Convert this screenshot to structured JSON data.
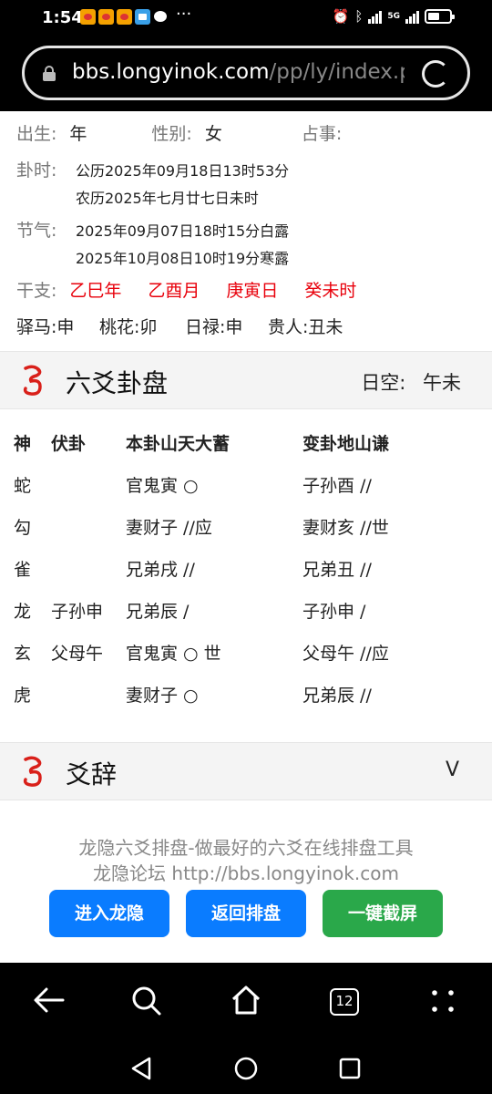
{
  "status_bar": {
    "time": "1:54",
    "more": "···",
    "network": "5G"
  },
  "browser": {
    "url_host": "bbs.longyinok.com",
    "url_path": "/pp/ly/index.ph"
  },
  "info": {
    "birth_label": "出生:",
    "birth_value": "年",
    "gender_label": "性别:",
    "gender_value": "女",
    "matter_label": "占事:",
    "time_label": "卦时:",
    "solar": "公历2025年09月18日13时53分",
    "lunar": "农历2025年七月廿七日未时",
    "term_label": "节气:",
    "term1": "2025年09月07日18时15分白露",
    "term2": "2025年10月08日10时19分寒露",
    "ganzhi_label": "干支:",
    "ganzhi": [
      "乙巳年",
      "乙酉月",
      "庚寅日",
      "癸未时"
    ],
    "shensha": [
      "驿马:申",
      "桃花:卯",
      "日禄:申",
      "贵人:丑未"
    ]
  },
  "liuyao_section": {
    "title": "六爻卦盘",
    "void_label": "日空:",
    "void_value": "午未"
  },
  "table": {
    "headers": [
      "神",
      "伏卦",
      "本卦山天大蓄",
      "变卦地山谦"
    ],
    "rows": [
      [
        "蛇",
        "",
        "官鬼寅 ○",
        "子孙酉 //"
      ],
      [
        "勾",
        "",
        "妻财子 //应",
        "妻财亥 //世"
      ],
      [
        "雀",
        "",
        "兄弟戌 //",
        "兄弟丑 //"
      ],
      [
        "龙",
        "子孙申",
        "兄弟辰  /",
        "子孙申  /"
      ],
      [
        "玄",
        "父母午",
        "官鬼寅 ○ 世",
        "父母午 //应"
      ],
      [
        "虎",
        "",
        "妻财子 ○",
        "兄弟辰 //"
      ]
    ]
  },
  "yaoci_section": {
    "title": "爻辞",
    "toggle": "V"
  },
  "footer": {
    "line1": "龙隐六爻排盘-做最好的六爻在线排盘工具",
    "line2": "龙隐论坛 http://bbs.longyinok.com",
    "buttons": [
      "进入龙隐",
      "返回排盘",
      "一键截屏"
    ],
    "button_colors": [
      "#0a7cff",
      "#0a7cff",
      "#2aa84a"
    ]
  },
  "browser_nav": {
    "tab_count": "12"
  },
  "colors": {
    "accent_red": "#e8000b",
    "blue": "#0a7cff",
    "green": "#2aa84a"
  }
}
